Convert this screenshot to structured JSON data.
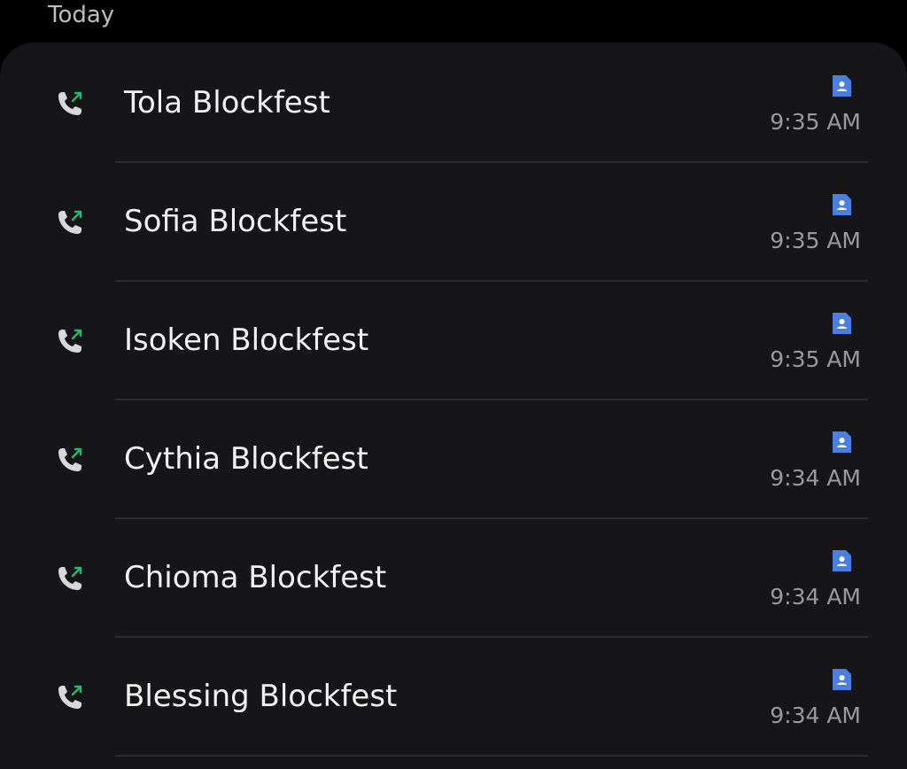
{
  "section": {
    "title": "Today"
  },
  "colors": {
    "background": "#000000",
    "card": "#161618",
    "outgoing_arrow": "#2bb673",
    "contact_badge": "#4a7fe0",
    "name_text": "#f2f2f2",
    "time_text": "#9a9a9c"
  },
  "icons": {
    "call_type": "outgoing-call-icon",
    "contact": "contact-card-icon"
  },
  "calls": [
    {
      "name": "Tola Blockfest",
      "time": "9:35 AM"
    },
    {
      "name": "Sofia Blockfest",
      "time": "9:35 AM"
    },
    {
      "name": "Isoken Blockfest",
      "time": "9:35 AM"
    },
    {
      "name": "Cythia Blockfest",
      "time": "9:34 AM"
    },
    {
      "name": "Chioma Blockfest",
      "time": "9:34 AM"
    },
    {
      "name": "Blessing Blockfest",
      "time": "9:34 AM"
    }
  ]
}
